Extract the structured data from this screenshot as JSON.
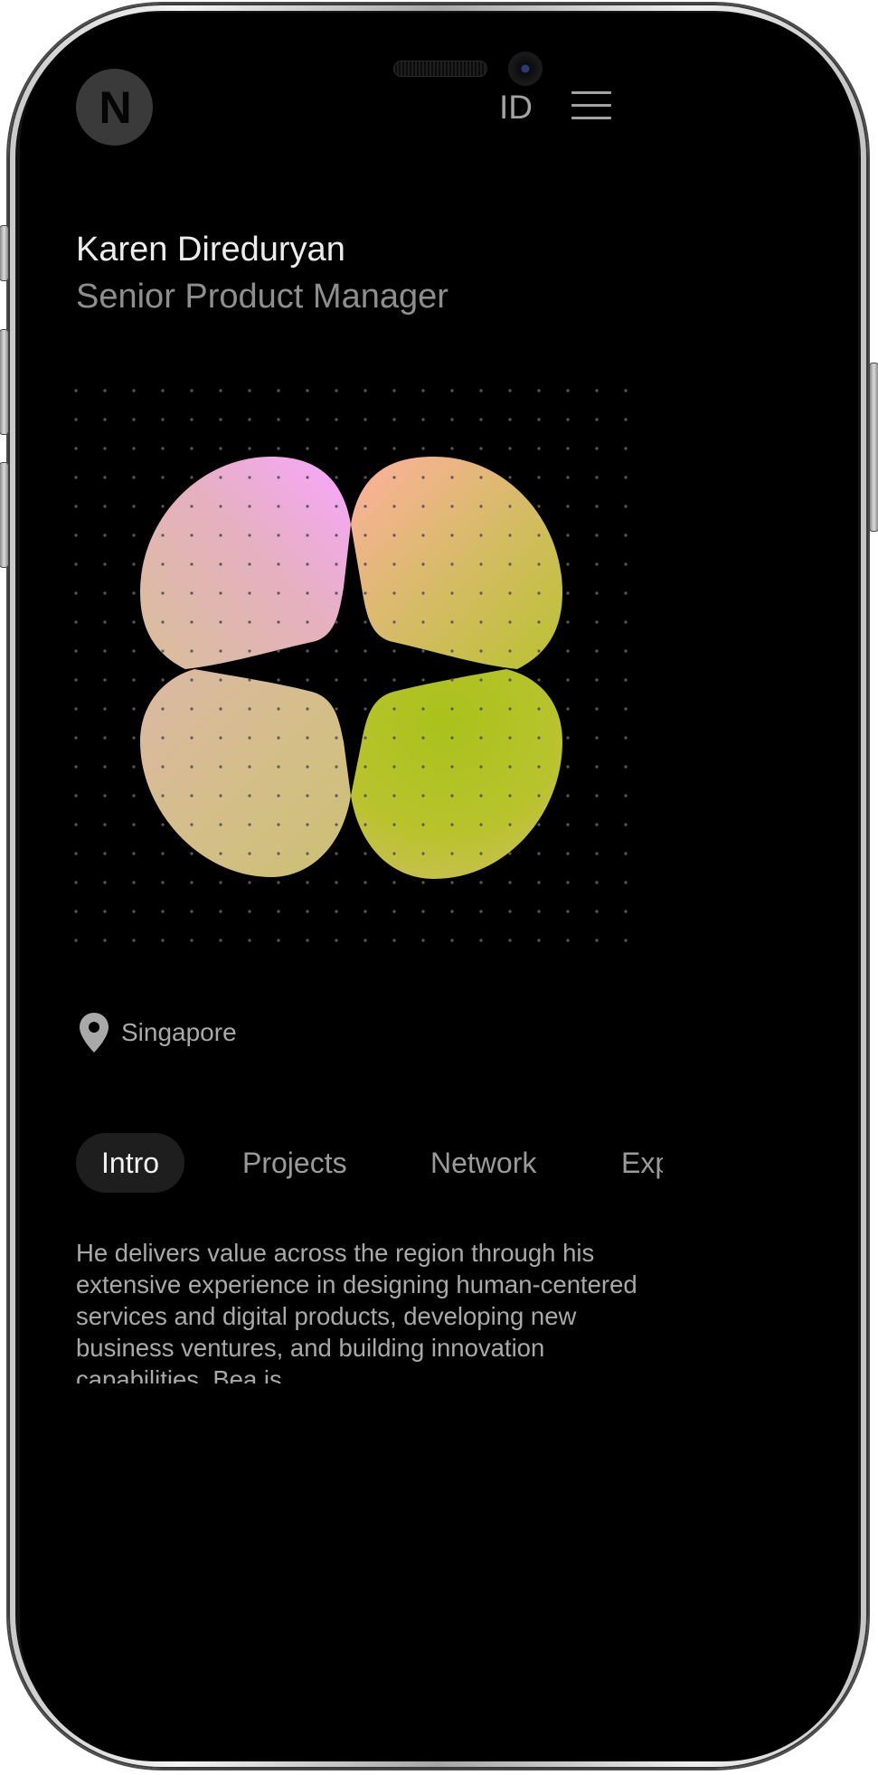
{
  "header": {
    "logo_letter": "N",
    "language_label": "ID"
  },
  "profile": {
    "name": "Karen Direduryan",
    "role": "Senior Product Manager",
    "location": "Singapore"
  },
  "tabs": [
    {
      "label": "Intro",
      "active": true
    },
    {
      "label": "Projects",
      "active": false
    },
    {
      "label": "Network",
      "active": false
    },
    {
      "label": "Experience",
      "active": false
    }
  ],
  "bio": {
    "text": "He delivers value across the region through his extensive experience in designing human-centered services and digital products, developing new business ventures, and building innovation capabilities. Bea is"
  },
  "colors": {
    "background": "#000000",
    "gradient_pink": "#f6a6ff",
    "gradient_peach": "#ffb29a",
    "gradient_tan": "#d8bd8a",
    "gradient_lime": "#aec420",
    "text_primary": "#ededed",
    "text_secondary": "#8e8e8e"
  },
  "icons": {
    "location": "map-pin-icon",
    "menu": "hamburger-menu-icon"
  }
}
